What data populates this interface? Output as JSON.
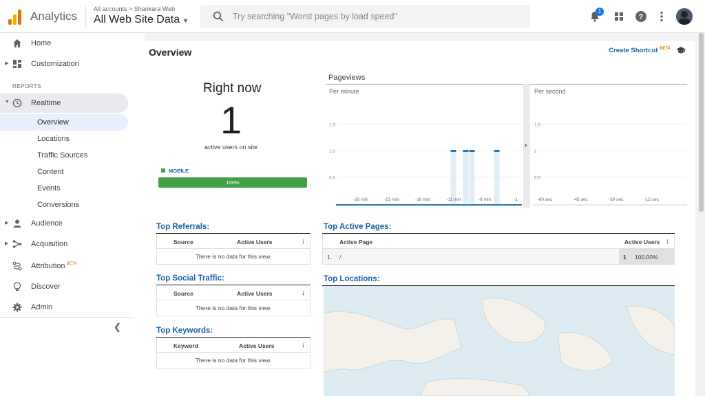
{
  "header": {
    "app_name": "Analytics",
    "breadcrumb": "All accounts > Shankara Web",
    "property": "All Web Site Data",
    "search_placeholder": "Try searching \"Worst pages by load speed\"",
    "notification_count": "1"
  },
  "sidebar": {
    "items_top": [
      {
        "label": "Home"
      },
      {
        "label": "Customization"
      }
    ],
    "reports_label": "REPORTS",
    "realtime": {
      "label": "Realtime"
    },
    "realtime_sub": [
      "Overview",
      "Locations",
      "Traffic Sources",
      "Content",
      "Events",
      "Conversions"
    ],
    "items_bottom": [
      {
        "label": "Audience"
      },
      {
        "label": "Acquisition"
      },
      {
        "label": "Attribution"
      },
      {
        "label": "Discover"
      },
      {
        "label": "Admin"
      }
    ],
    "attribution_badge": "BETA"
  },
  "main": {
    "title": "Overview",
    "shortcut": "Create Shortcut",
    "shortcut_badge": "BETA",
    "right_now": {
      "title": "Right now",
      "count": "1",
      "subtitle": "active users on site",
      "device_label": "MOBILE",
      "device_percent": "100%",
      "device_fraction": 1.0
    },
    "pageviews_title": "Pageviews",
    "per_minute_label": "Per minute",
    "per_second_label": "Per second",
    "top_referrals": {
      "title": "Top Referrals:",
      "col1": "Source",
      "col2": "Active Users",
      "empty": "There is no data for this view."
    },
    "top_social": {
      "title": "Top Social Traffic:",
      "col1": "Source",
      "col2": "Active Users",
      "empty": "There is no data for this view."
    },
    "top_keywords": {
      "title": "Top Keywords:",
      "col1": "Keyword",
      "col2": "Active Users",
      "empty": "There is no data for this view."
    },
    "top_pages": {
      "title": "Top Active Pages:",
      "col1": "Active Page",
      "col2": "Active Users",
      "rows": [
        {
          "num": "1.",
          "page": "/",
          "users": "1",
          "percent": "100.00%"
        }
      ]
    },
    "top_locations": {
      "title": "Top Locations:"
    }
  },
  "chart_data": [
    {
      "type": "bar",
      "title": "Per minute",
      "x_ticks": [
        "-26 min",
        "-21 min",
        "-16 min",
        "-11 min",
        "-6 min",
        "-1"
      ],
      "y_ticks": [
        "0.5",
        "1.0",
        "1.5"
      ],
      "ylim": [
        0,
        2
      ],
      "bars": [
        {
          "x": -11,
          "value": 1
        },
        {
          "x": -9,
          "value": 1
        },
        {
          "x": -8,
          "value": 1
        },
        {
          "x": -4,
          "value": 1
        }
      ],
      "color": "#1f78b4"
    },
    {
      "type": "bar",
      "title": "Per second",
      "x_ticks": [
        "-60 sec",
        "-45 sec",
        "-30 sec",
        "-15 sec"
      ],
      "y_ticks": [
        "0.5",
        "1",
        "1.5"
      ],
      "ylim": [
        0,
        2
      ],
      "bars": []
    }
  ]
}
